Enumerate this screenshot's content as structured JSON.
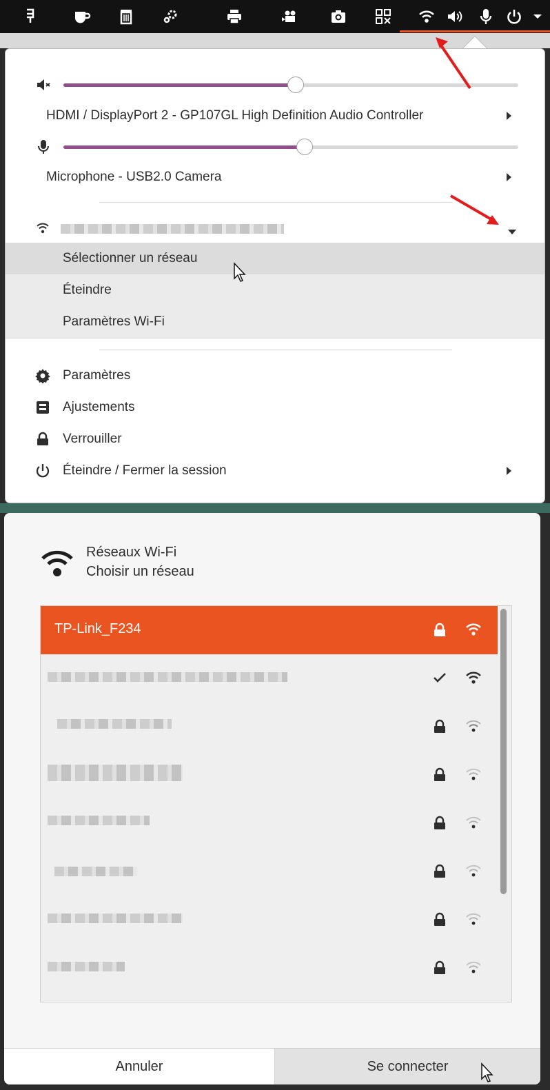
{
  "topbar": {
    "icons": [
      "terminal-app-icon",
      "coffee-icon",
      "trash-icon",
      "settings-gears-icon",
      "printer-icon",
      "video-camera-icon",
      "camera-icon",
      "qr-grid-icon",
      "wifi-icon",
      "volume-icon",
      "microphone-icon",
      "power-icon",
      "chevron-down-icon"
    ],
    "accent": "#e95420"
  },
  "system_menu": {
    "output_device": "HDMI / DisplayPort 2 - GP107GL High Definition Audio Controller",
    "output_volume": 0.51,
    "input_device": "Microphone - USB2.0 Camera",
    "input_volume": 0.53,
    "wifi_submenu": [
      "Sélectionner un réseau",
      "Éteindre",
      "Paramètres Wi-Fi"
    ],
    "items": [
      {
        "label": "Paramètres",
        "icon": "gear-icon"
      },
      {
        "label": "Ajustements",
        "icon": "tweaks-icon"
      },
      {
        "label": "Verrouiller",
        "icon": "lock-icon"
      },
      {
        "label": "Éteindre / Fermer la session",
        "icon": "power-icon"
      }
    ],
    "slider_color": "#924d8b"
  },
  "wifi_dialog": {
    "title": "Réseaux Wi-Fi",
    "subtitle": "Choisir un réseau",
    "selected_network": "TP-Link_F234",
    "networks": [
      {
        "status": "locked",
        "signal": "full"
      },
      {
        "status": "connected",
        "signal": "full"
      },
      {
        "status": "locked",
        "signal": "weak"
      },
      {
        "status": "locked",
        "signal": "weak"
      },
      {
        "status": "locked",
        "signal": "weak"
      },
      {
        "status": "locked",
        "signal": "weak"
      },
      {
        "status": "locked",
        "signal": "weak"
      },
      {
        "status": "locked",
        "signal": "weak"
      }
    ],
    "cancel_label": "Annuler",
    "connect_label": "Se connecter"
  }
}
